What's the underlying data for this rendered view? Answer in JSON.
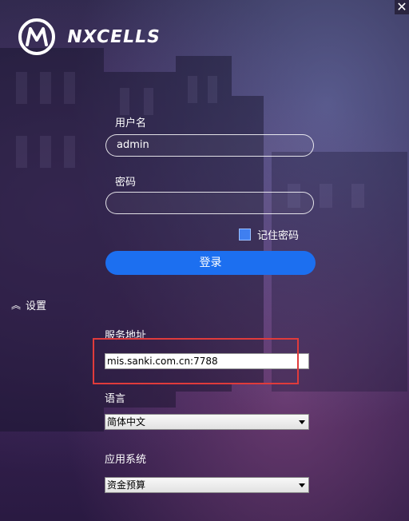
{
  "window": {
    "close_glyph": "✕"
  },
  "brand": {
    "logo_icon": "nxcells-logo-icon",
    "name": "NXCELLS"
  },
  "login": {
    "username_label": "用户名",
    "username_value": "admin",
    "password_label": "密码",
    "password_value": "",
    "remember_label": "记住密码",
    "remember_checked": true,
    "login_button": "登录"
  },
  "settings": {
    "toggle_icon": "chevron-double-up-icon",
    "toggle_glyph": "︽",
    "toggle_label": "设置",
    "server_label": "服务地址",
    "server_value": "mis.sanki.com.cn:7788",
    "language_label": "语言",
    "language_value": "简体中文",
    "system_label": "应用系统",
    "system_value": "资金预算"
  },
  "colors": {
    "accent": "#1c6ff0",
    "checkbox": "#3f7ff0",
    "highlight": "#e03b3b"
  }
}
